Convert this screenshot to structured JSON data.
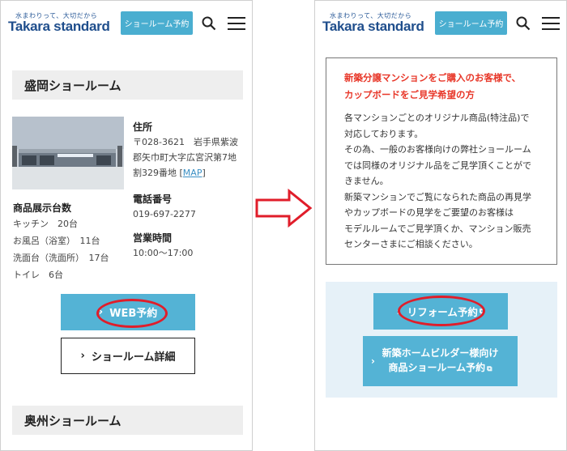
{
  "brand": {
    "tagline": "水まわりって、大切だから",
    "name": "Takara standard"
  },
  "header": {
    "reserve_label": "ショールーム予約"
  },
  "left": {
    "section_title": "盛岡ショールーム",
    "address_label": "住所",
    "address_lines": [
      "〒028-3621　岩手県紫波",
      "郡矢巾町大字広宮沢第7地",
      "割329番地 "
    ],
    "map_label": "MAP",
    "phone_label": "電話番号",
    "phone": "019-697-2277",
    "hours_label": "営業時間",
    "hours": "10:00～17:00",
    "display_label": "商品展示台数",
    "display_items": [
      "キッチン　20台",
      "お風呂（浴室）　11台",
      "洗面台（洗面所）　17台",
      "トイレ　6台"
    ],
    "web_button": "WEB予約",
    "detail_button": "ショールーム詳細",
    "next_section_title": "奥州ショールーム"
  },
  "right": {
    "notice_title_lines": [
      "新築分譲マンションをご購入のお客様で、",
      "カップボードをご見学希望の方"
    ],
    "notice_body_lines": [
      "各マンションごとのオリジナル商品(特注品)で",
      "対応しております。",
      "その為、一般のお客様向けの弊社ショールーム",
      "では同様のオリジナル品をご見学頂くことがで",
      "きません。",
      "新築マンションでご覧になられた商品の再見学",
      "やカップボードの見学をご要望のお客様は",
      "モデルルームでご見学頂くか、マンション販売",
      "センターさまにご相談ください。"
    ],
    "reform_button": "リフォーム予約",
    "builder_button_lines": [
      "新築ホームビルダー様向け",
      "商品ショールーム予約"
    ]
  },
  "colors": {
    "accent_blue": "#54b3d5",
    "highlight_red": "#e01d2a",
    "notice_red": "#e8382a"
  }
}
